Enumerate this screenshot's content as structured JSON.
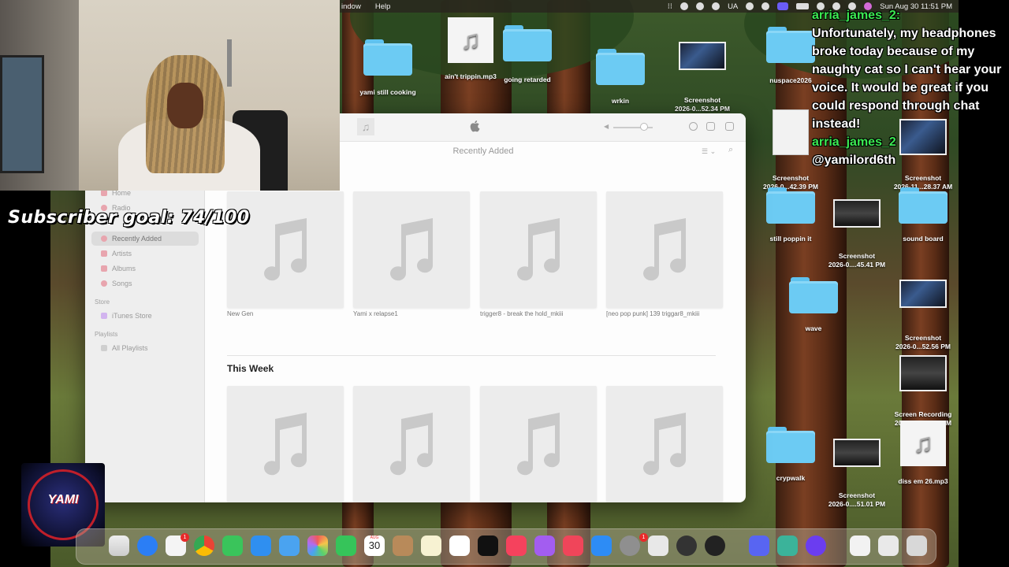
{
  "menubar": {
    "items": [
      "indow",
      "Help"
    ],
    "status_text_ua": "UA",
    "datetime": "Sun Aug 30  11:51 PM"
  },
  "desktop_icons": [
    {
      "label": "yami still cooking",
      "kind": "folder"
    },
    {
      "label": "ain't trippin.mp3",
      "kind": "doc"
    },
    {
      "label": "going retarded",
      "kind": "folder"
    },
    {
      "label": "wrkin",
      "kind": "folder"
    },
    {
      "label": "Screenshot\n2026-0...52.34 PM",
      "kind": "thumb"
    },
    {
      "label": "nuspace2026",
      "kind": "folder"
    },
    {
      "label": "Screenshot\n2026-0...42.39 PM",
      "kind": "paper"
    },
    {
      "label": "Screenshot\n2026-11...28.37 AM",
      "kind": "thumb"
    },
    {
      "label": "still poppin it",
      "kind": "folder"
    },
    {
      "label": "Screenshot\n2026-0....45.41 PM",
      "kind": "dark"
    },
    {
      "label": "sound board",
      "kind": "folder"
    },
    {
      "label": "wave",
      "kind": "folder"
    },
    {
      "label": "Screenshot\n2026-0...52.56 PM",
      "kind": "thumb"
    },
    {
      "label": "Screen Recording\n2026-0....53.15 PM",
      "kind": "dark"
    },
    {
      "label": "crypwalk",
      "kind": "folder"
    },
    {
      "label": "Screenshot\n2026-0....51.01 PM",
      "kind": "dark"
    },
    {
      "label": "diss em 26.mp3",
      "kind": "doc"
    }
  ],
  "chat": {
    "username1": "arria_james_2:",
    "message1": "Unfortunately, my headphones broke today because of my naughty cat so I can't hear your voice. It would be great if you could respond through chat instead!",
    "username2": "arria_james_2",
    "message2": "@yamilord6th"
  },
  "music": {
    "page_title": "Recently Added",
    "sidebar": {
      "nav": [
        {
          "label": "Home",
          "color": "#e84a5f"
        },
        {
          "label": "Radio",
          "color": "#e84a5f"
        },
        {
          "label": "Recently Added",
          "color": "#e84a5f",
          "active": true
        },
        {
          "label": "Artists",
          "color": "#e84a5f"
        },
        {
          "label": "Albums",
          "color": "#e84a5f"
        },
        {
          "label": "Songs",
          "color": "#e84a5f"
        }
      ],
      "store_heading": "Store",
      "store_item": "iTunes Store",
      "playlists_heading": "Playlists",
      "playlists_item": "All Playlists"
    },
    "recent_albums": [
      "New Gen",
      "Yami x relapse1",
      "trigger8 - break the hold_mkiii",
      "[neo pop punk] 139 triggar8_mkiii"
    ],
    "this_week_title": "This Week"
  },
  "overlay": {
    "subscriber_goal": "Subscriber goal: 74/100",
    "logo_text": "YAMI"
  },
  "dock": {
    "calendar_month": "AUG",
    "calendar_day": "30",
    "badge1": "1",
    "badge2": "1"
  }
}
